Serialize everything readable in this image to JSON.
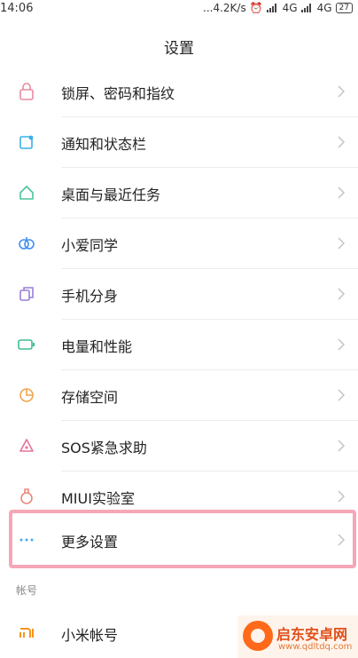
{
  "status_bar": {
    "time": "14:06",
    "net_speed": "...4.2K/s",
    "signal_1": "4G",
    "signal_2": "4G",
    "battery": "27"
  },
  "header": {
    "title": "设置"
  },
  "menu": {
    "items": [
      {
        "label": "锁屏、密码和指纹",
        "icon": "lock-icon",
        "color": "#e88aa0"
      },
      {
        "label": "通知和状态栏",
        "icon": "notification-icon",
        "color": "#3ab0e6"
      },
      {
        "label": "桌面与最近任务",
        "icon": "home-icon",
        "color": "#4cc49a"
      },
      {
        "label": "小爱同学",
        "icon": "xiaoai-icon",
        "color": "#3f8ff0"
      },
      {
        "label": "手机分身",
        "icon": "dual-space-icon",
        "color": "#9b7ed6"
      },
      {
        "label": "电量和性能",
        "icon": "battery-icon",
        "color": "#3cbf8e"
      },
      {
        "label": "存储空间",
        "icon": "storage-icon",
        "color": "#f2a44a"
      },
      {
        "label": "SOS紧急求助",
        "icon": "sos-icon",
        "color": "#e8709a"
      },
      {
        "label": "MIUI实验室",
        "icon": "lab-icon",
        "color": "#e88a7a"
      },
      {
        "label": "更多设置",
        "icon": "more-icon",
        "color": "#4aa8e8"
      }
    ]
  },
  "account_section": {
    "header": "帐号",
    "items": [
      {
        "label": "小米帐号",
        "icon": "mi-logo-icon",
        "color": "#f7941d"
      }
    ]
  },
  "watermark": {
    "name": "启东安卓网",
    "url": "www.qdltdq.com"
  }
}
